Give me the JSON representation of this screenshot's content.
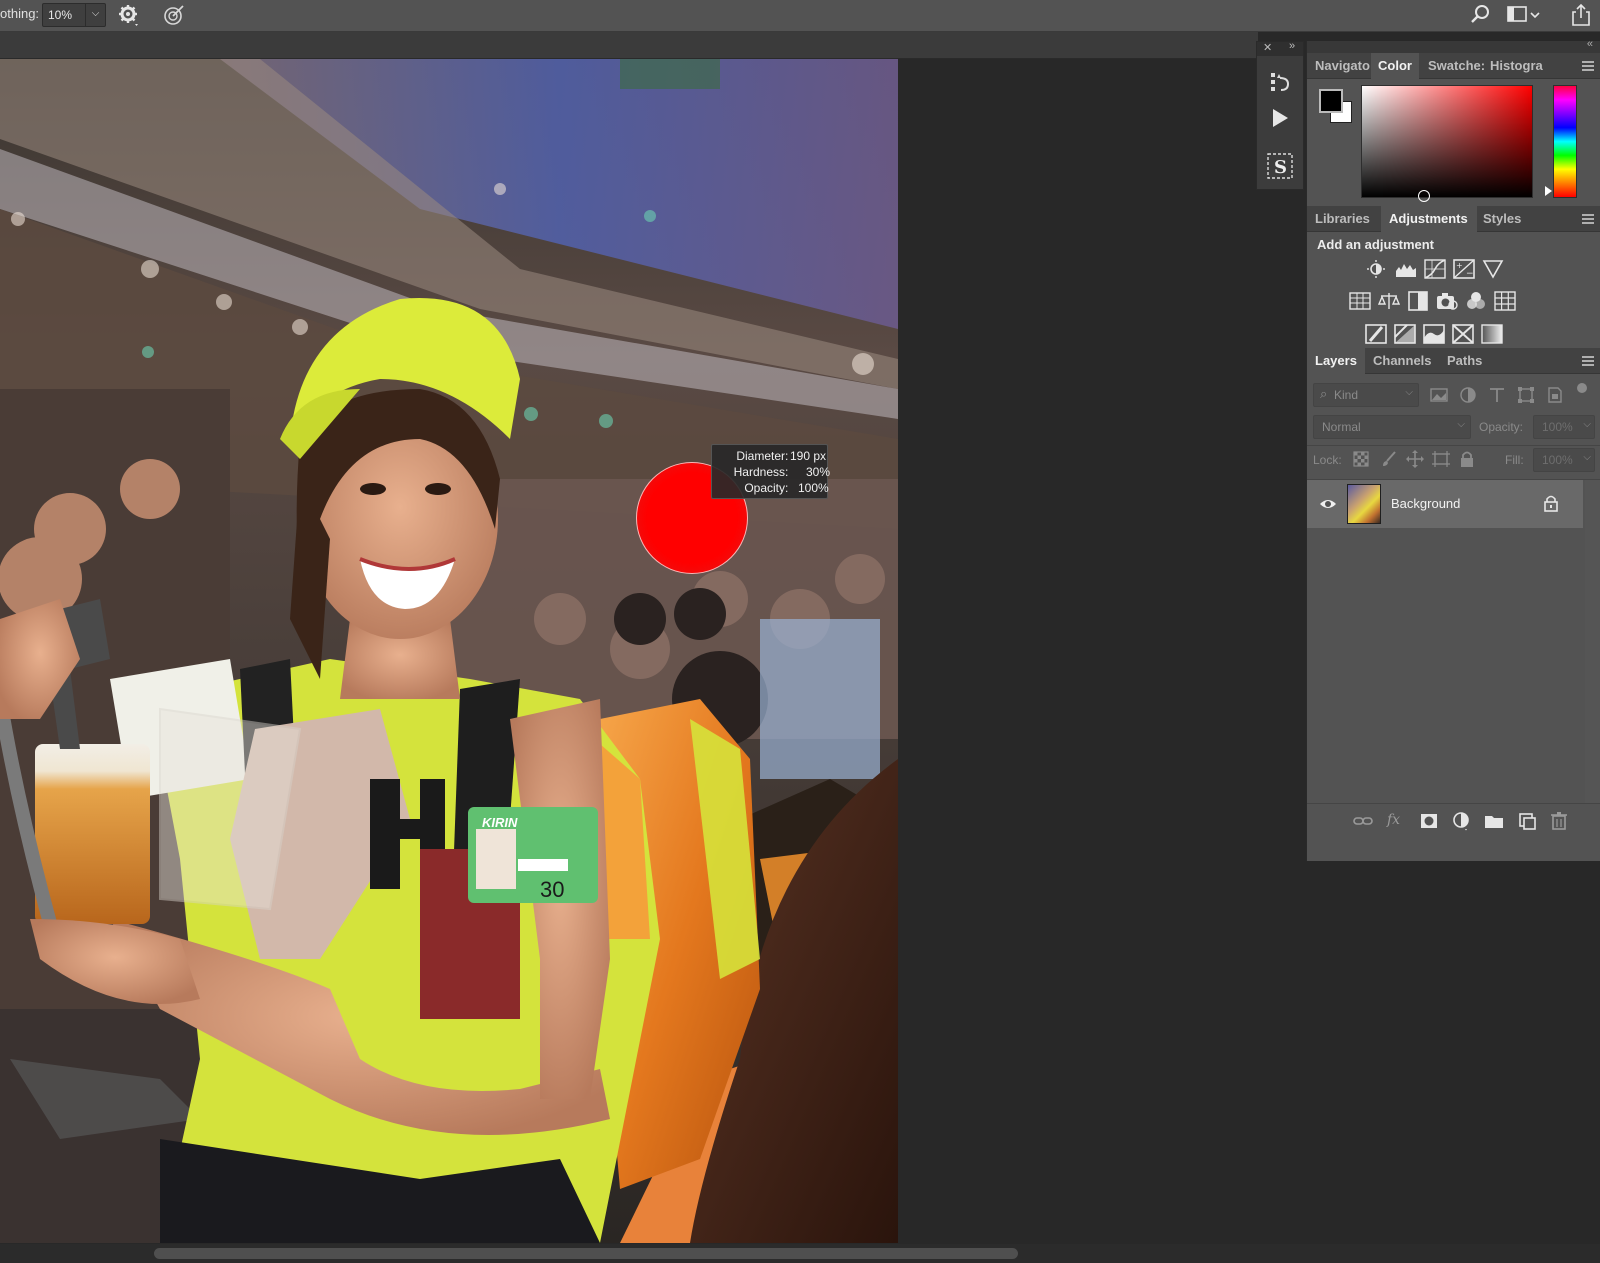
{
  "options_bar": {
    "smoothing_label": "othing:",
    "smoothing_value": "10%",
    "icons": [
      "gear-icon",
      "pressure-icon",
      "search-icon",
      "workspace-icon",
      "share-icon"
    ]
  },
  "brush_tooltip": {
    "diameter_label": "Diameter",
    "diameter_value": "190 px",
    "hardness_label": "Hardness",
    "hardness_value": "30%",
    "opacity_label": "Opacity",
    "opacity_value": "100%"
  },
  "color_panel": {
    "tabs": [
      "Navigato",
      "Color",
      "Swatche:",
      "Histogra"
    ],
    "active_tab": "Color",
    "foreground": "#000000",
    "background": "#ffffff",
    "hue": "#ff0000"
  },
  "adjustments_panel": {
    "tabs": [
      "Libraries",
      "Adjustments",
      "Styles"
    ],
    "active_tab": "Adjustments",
    "heading": "Add an adjustment"
  },
  "layers_panel": {
    "tabs": [
      "Layers",
      "Channels",
      "Paths"
    ],
    "active_tab": "Layers",
    "filter_placeholder": "Kind",
    "blend_mode": "Normal",
    "opacity_label": "Opacity:",
    "opacity_value": "100%",
    "lock_label": "Lock:",
    "fill_label": "Fill:",
    "fill_value": "100%",
    "layers": [
      {
        "name": "Background",
        "visible": true,
        "locked": true
      }
    ]
  }
}
